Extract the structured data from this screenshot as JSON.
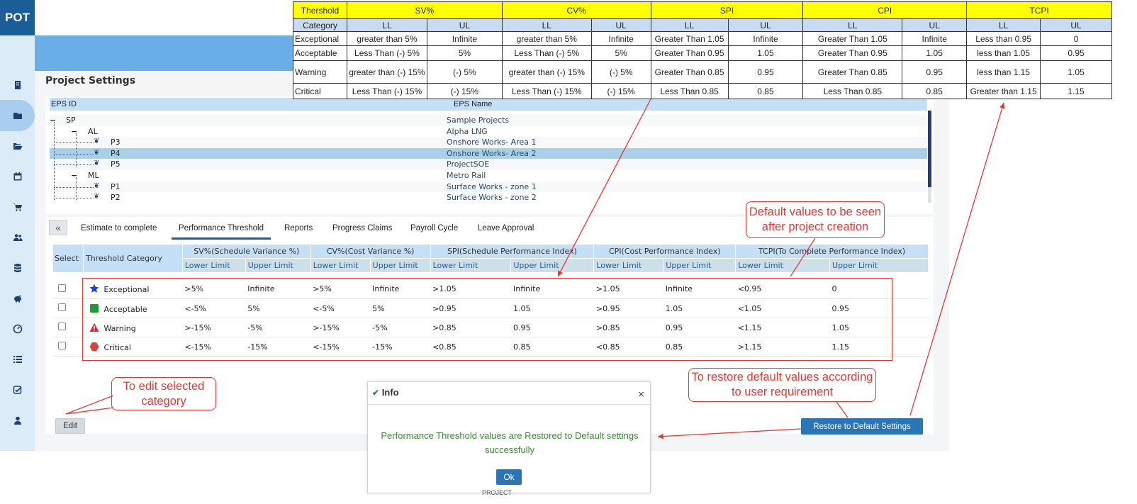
{
  "app": {
    "logo": "POT"
  },
  "page_title": "Project Settings",
  "sidebar": {
    "items": [
      {
        "icon": "building-icon",
        "active": false
      },
      {
        "icon": "folder-icon",
        "active": true
      },
      {
        "icon": "folder-open-icon",
        "active": false
      },
      {
        "icon": "calendar-icon",
        "active": false
      },
      {
        "icon": "cart-icon",
        "active": false
      },
      {
        "icon": "users-icon",
        "active": false
      },
      {
        "icon": "database-icon",
        "active": false
      },
      {
        "icon": "piggy-bank-icon",
        "active": false
      },
      {
        "icon": "dashboard-icon",
        "active": false
      },
      {
        "icon": "list-icon",
        "active": false
      },
      {
        "icon": "check-square-icon",
        "active": false
      },
      {
        "icon": "user-icon",
        "active": false
      }
    ]
  },
  "eps": {
    "headers": {
      "id": "EPS ID",
      "name": "EPS Name"
    },
    "rows": [
      {
        "id": "SP",
        "name": "Sample Projects",
        "selected": false
      },
      {
        "id": "AL",
        "name": "Alpha LNG",
        "selected": false
      },
      {
        "id": "P3",
        "name": "Onshore Works- Area 1",
        "selected": false
      },
      {
        "id": "P4",
        "name": "Onshore Works- Area 2",
        "selected": true
      },
      {
        "id": "P5",
        "name": "ProjectSOE",
        "selected": false
      },
      {
        "id": "ML",
        "name": "Metro Rail",
        "selected": false
      },
      {
        "id": "P1",
        "name": "Surface Works - zone 1",
        "selected": false
      },
      {
        "id": "P2",
        "name": "Surface Works - zone 2",
        "selected": false
      }
    ]
  },
  "tabs": {
    "collapse": "«",
    "items": [
      {
        "label": "Estimate to complete",
        "active": false
      },
      {
        "label": "Performance Threshold",
        "active": true
      },
      {
        "label": "Reports",
        "active": false
      },
      {
        "label": "Progress Claims",
        "active": false
      },
      {
        "label": "Payroll Cycle",
        "active": false
      },
      {
        "label": "Leave Approval",
        "active": false
      }
    ]
  },
  "threshold_table": {
    "col_select": "Select",
    "col_category": "Threshold Category",
    "groups": [
      "SV%(Schedule Variance %)",
      "CV%(Cost Variance %)",
      "SPI(Schedule Performance Index)",
      "CPI(Cost Performance Index)",
      "TCPI(To Complete Performance Index)"
    ],
    "lower": "Lower Limit",
    "upper": "Upper Limit",
    "rows": [
      {
        "category": "Exceptional",
        "icon": "star-icon",
        "color": "#1a3fd9",
        "values": [
          ">5%",
          "Infinite",
          ">5%",
          "Infinite",
          ">1.05",
          "Infinite",
          ">1.05",
          "Infinite",
          "<0.95",
          "0"
        ]
      },
      {
        "category": "Acceptable",
        "icon": "square-icon",
        "color": "#1e9a2e",
        "values": [
          "<-5%",
          "5%",
          "<-5%",
          "5%",
          ">0.95",
          "1.05",
          ">0.95",
          "1.05",
          "<1.05",
          "0.95"
        ]
      },
      {
        "category": "Warning",
        "icon": "warning-icon",
        "color": "#e32a2a",
        "values": [
          ">-15%",
          "-5%",
          ">-15%",
          "-5%",
          ">0.85",
          "0.95",
          ">0.85",
          "0.95",
          "<1.15",
          "1.05"
        ]
      },
      {
        "category": "Critical",
        "icon": "hexagon-icon",
        "color": "#d6453d",
        "values": [
          "<-15%",
          "-15%",
          "<-15%",
          "-15%",
          "<0.85",
          "0.85",
          "<0.85",
          "0.85",
          ">1.15",
          "1.15"
        ]
      }
    ]
  },
  "buttons": {
    "edit": "Edit",
    "restore": "Restore to Default Settings"
  },
  "dialog": {
    "title": "Info",
    "close": "×",
    "message": "Performance Threshold values are Restored to Default settings successfully",
    "ok": "Ok",
    "under_text": "PROJECT"
  },
  "reference_table": {
    "head_col1_top": "Thershold",
    "head_col1_bottom": "Category",
    "groups": [
      "SV%",
      "CV%",
      "SPI",
      "CPI",
      "TCPI"
    ],
    "ll": "LL",
    "ul": "UL",
    "rows": [
      {
        "category": "Exceptional",
        "values": [
          "greater than 5%",
          "Infinite",
          "greater than 5%",
          "Infinite",
          "Greater Than 1.05",
          "Infinite",
          "Greater Than 1.05",
          "Infinite",
          "Less than 0.95",
          "0"
        ]
      },
      {
        "category": "Acceptable",
        "values": [
          "Less Than (-) 5%",
          "5%",
          "Less Than (-) 5%",
          "5%",
          "Greater Than 0.95",
          "1.05",
          "Greater Than 0.95",
          "1.05",
          "less than 1.05",
          "0.95"
        ]
      },
      {
        "category": "Warning",
        "values": [
          "greater than (-) 15%",
          "(-) 5%",
          "greater than (-) 15%",
          "(-) 5%",
          "Greater Than 0.85",
          "0.95",
          "Greater Than 0.85",
          "0.95",
          "less than 1.15",
          "1.05"
        ]
      },
      {
        "category": "Critical",
        "values": [
          "Less Than  (-) 15%",
          "(-) 15%",
          "Less Than  (-) 15%",
          "(-) 15%",
          "Less Than  0.85",
          "0.85",
          "Less Than  0.85",
          "0.85",
          "Greater than 1.15",
          "1.15"
        ]
      }
    ]
  },
  "callouts": {
    "default_values": "Default values to be seen after project creation",
    "edit_category": "To edit selected category",
    "restore_defaults": "To restore default values according to user requirement"
  },
  "colors": {
    "sidebar_bg": "#dcebf8",
    "header_bg": "#6aaee8",
    "logo_bg": "#1b5d97",
    "accent": "#2b75b6",
    "callout": "#e53935",
    "success_text": "#3b8a36",
    "ref_header": "#ffff00"
  }
}
